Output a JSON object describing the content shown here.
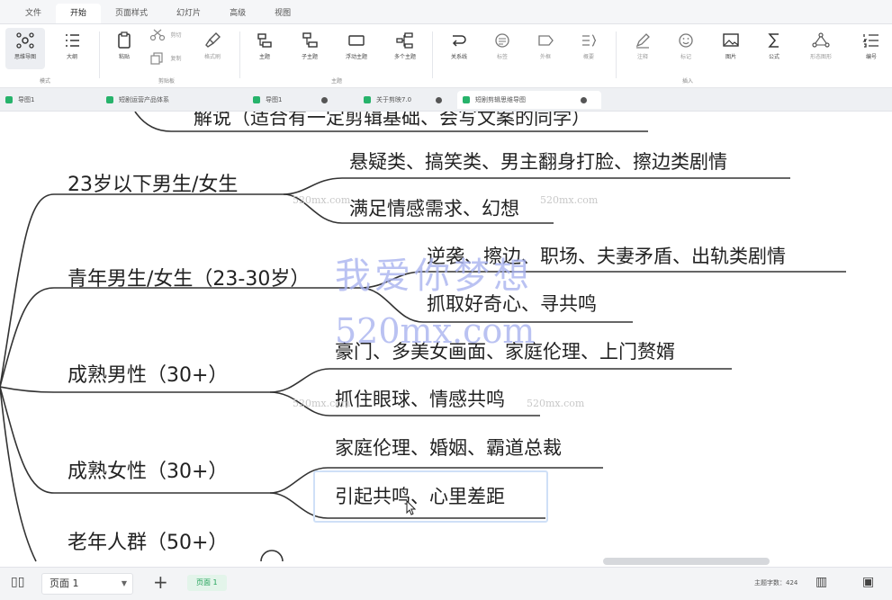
{
  "menubar": {
    "tabs": [
      {
        "label": "文件"
      },
      {
        "label": "开始"
      },
      {
        "label": "页面样式"
      },
      {
        "label": "幻灯片"
      },
      {
        "label": "高级"
      },
      {
        "label": "视图"
      }
    ]
  },
  "ribbon": {
    "mind_map": "思维导图",
    "outline": "大纲",
    "paste": "粘贴",
    "cut": "剪切",
    "copy": "复制",
    "format_brush": "格式刷",
    "topic": "主题",
    "subtopic": "子主题",
    "float_topic": "浮动主题",
    "multi_topic": "多个主题",
    "relation": "关系线",
    "label": "标签",
    "outline_box": "外框",
    "summary": "概要",
    "note": "注释",
    "mark": "标记",
    "image": "图片",
    "formula": "公式",
    "smart_graph": "形态图形",
    "numbering": "编号",
    "group_mode": "模式",
    "group_clipboard": "剪贴板",
    "group_topic": "主题",
    "group_insert": "插入"
  },
  "doctabs": [
    {
      "label": "导图1"
    },
    {
      "label": "短剧运营产品体系"
    },
    {
      "label": "导图1"
    },
    {
      "label": "关于剪映7.0"
    },
    {
      "label": "短剧剪辑思维导图"
    }
  ],
  "mindmap": {
    "cut_top_text": "解说（适合有一定剪辑基础、会写文案的同学）",
    "branches": [
      {
        "title": "23岁以下男生/女生",
        "leaves": [
          "悬疑类、搞笑类、男主翻身打脸、擦边类剧情",
          "满足情感需求、幻想"
        ]
      },
      {
        "title": "青年男生/女生（23-30岁）",
        "leaves": [
          "逆袭、擦边、职场、夫妻矛盾、出轨类剧情",
          "抓取好奇心、寻共鸣"
        ]
      },
      {
        "title": "成熟男性（30+）",
        "leaves": [
          "豪门、多美女画面、家庭伦理、上门赘婿",
          "抓住眼球、情感共鸣"
        ]
      },
      {
        "title": "成熟女性（30+）",
        "leaves": [
          "家庭伦理、婚姻、霸道总裁",
          "引起共鸣、心里差距"
        ]
      },
      {
        "title": "老年人群（50+）",
        "leaves": []
      }
    ]
  },
  "watermarks": {
    "main_cn": "我爱你梦想",
    "main_url": "520mx.com",
    "small": "520mx.com"
  },
  "statusbar": {
    "page_select": "页面 1",
    "page_tab": "页面 1",
    "topic_count": "主题字数：424"
  },
  "colors": {
    "accent_green": "#27b36b",
    "selection_border": "#cfe0f7",
    "watermark": "#aab4f0"
  }
}
